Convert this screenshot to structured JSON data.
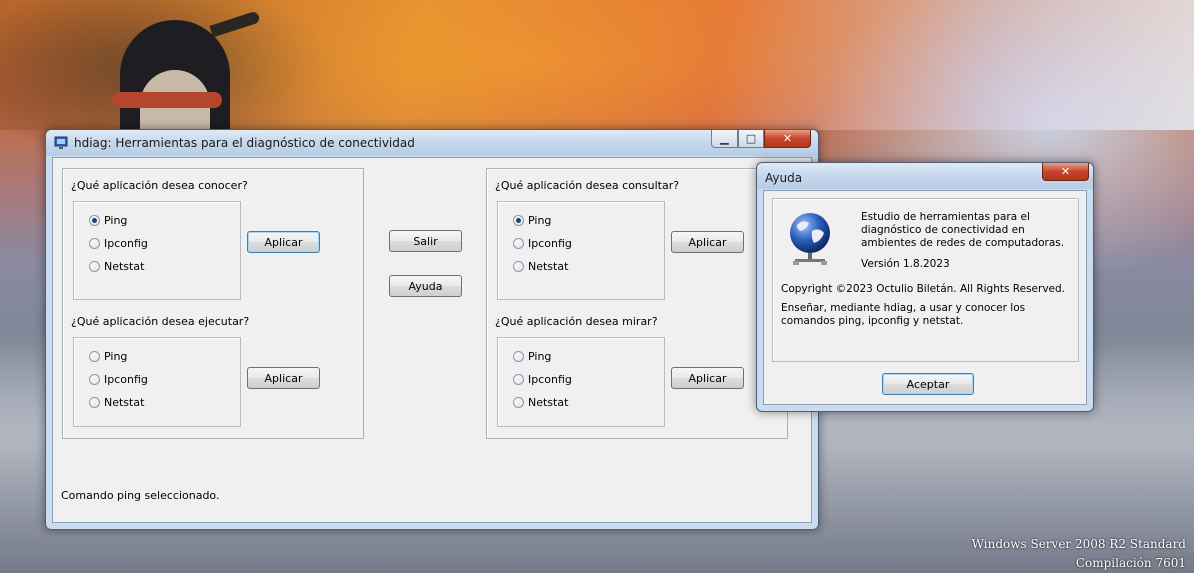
{
  "main_window": {
    "title": "hdiag: Herramientas para el diagnóstico de conectividad",
    "controls": {
      "minimize": "▁",
      "maximize": "□",
      "close": "✕"
    },
    "groups": {
      "conocer": {
        "label": "¿Qué aplicación desea conocer?",
        "options": [
          "Ping",
          "Ipconfig",
          "Netstat"
        ],
        "selected": "Ping",
        "button": "Aplicar"
      },
      "ejecutar": {
        "label": "¿Qué aplicación desea ejecutar?",
        "options": [
          "Ping",
          "Ipconfig",
          "Netstat"
        ],
        "selected": "",
        "button": "Aplicar"
      },
      "consultar": {
        "label": "¿Qué aplicación desea consultar?",
        "options": [
          "Ping",
          "Ipconfig",
          "Netstat"
        ],
        "selected": "Ping",
        "button": "Aplicar"
      },
      "mirar": {
        "label": "¿Qué aplicación desea mirar?",
        "options": [
          "Ping",
          "Ipconfig",
          "Netstat"
        ],
        "selected": "",
        "button": "Aplicar"
      }
    },
    "salir_label": "Salir",
    "ayuda_label": "Ayuda",
    "status": "Comando ping seleccionado."
  },
  "help_dialog": {
    "title": "Ayuda",
    "close": "✕",
    "description": "Estudio de herramientas para el diagnóstico de conectividad en ambientes de redes de computadoras.",
    "version": "Versión 1.8.2023",
    "copyright": "Copyright ©2023 Octulio Biletán. All Rights Reserved.",
    "info": "Enseñar, mediante hdiag, a usar y conocer los comandos ping, ipconfig y netstat.",
    "accept_label": "Aceptar",
    "icon": "network-globe-icon"
  },
  "desktop": {
    "os_name": "Windows Server 2008 R2 Standard",
    "build": "Compilación  7601"
  },
  "colors": {
    "title_text": "#1a1a1a",
    "default_button_border": "#3c7fb1",
    "close_button": "#c7452a"
  }
}
